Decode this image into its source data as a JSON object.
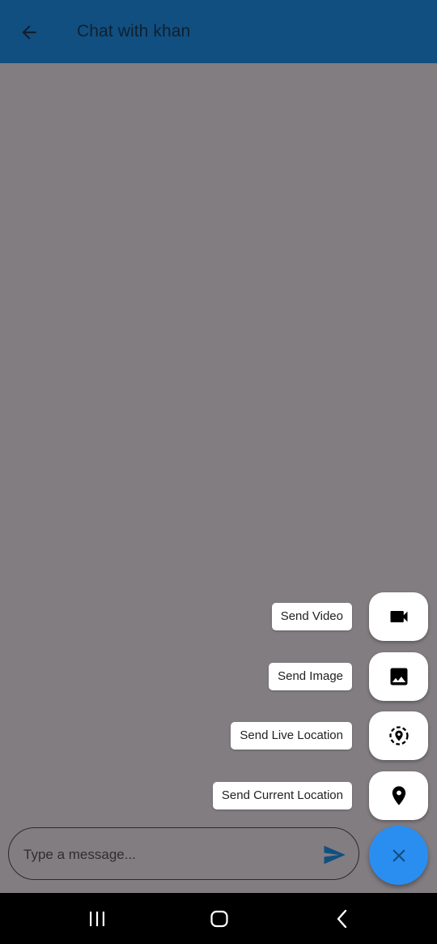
{
  "app_bar": {
    "title": "Chat with khan",
    "back_icon": "arrow-back-icon",
    "background": "#114f80"
  },
  "fab_menu": {
    "items": [
      {
        "label": "Send Video",
        "icon": "videocam-icon"
      },
      {
        "label": "Send Image",
        "icon": "image-icon"
      },
      {
        "label": "Send Live Location",
        "icon": "live-location-icon"
      },
      {
        "label": "Send Current Location",
        "icon": "location-pin-icon"
      }
    ],
    "main_fab": {
      "icon": "close-icon",
      "color": "#2a8ef1"
    }
  },
  "composer": {
    "placeholder": "Type a message...",
    "value": "",
    "send_icon": "send-icon",
    "send_color": "#114f80"
  },
  "nav_bar": {
    "buttons": [
      "recents-icon",
      "home-icon",
      "back-icon"
    ]
  },
  "colors": {
    "scrim": "#827d81",
    "nav_bar": "#000000"
  }
}
